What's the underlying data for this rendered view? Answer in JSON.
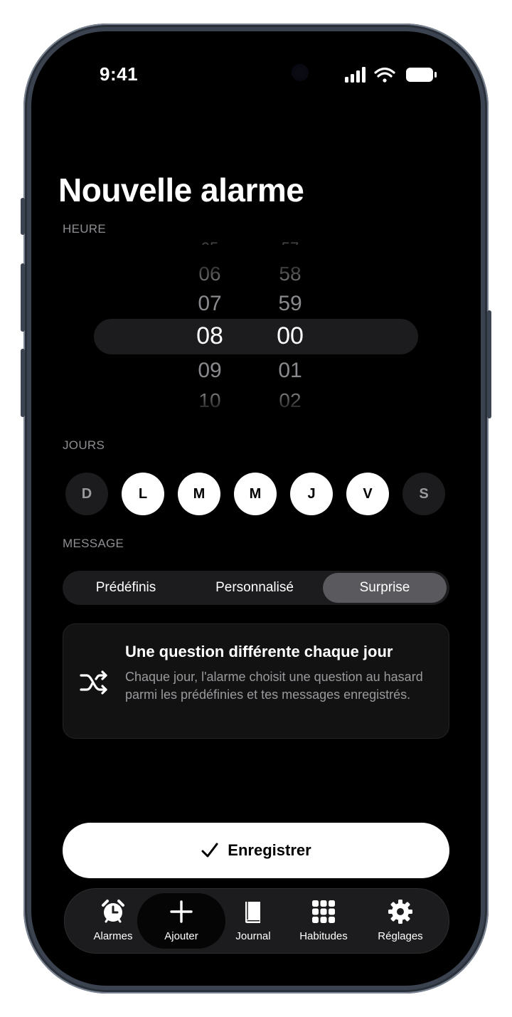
{
  "status": {
    "time": "9:41"
  },
  "page": {
    "title": "Nouvelle alarme"
  },
  "heure": {
    "label": "HEURE",
    "hours": [
      "06",
      "07",
      "08",
      "09",
      "10"
    ],
    "minutes": [
      "58",
      "59",
      "00",
      "01",
      "02"
    ],
    "selected_hour": "08",
    "selected_minute": "00"
  },
  "jours": {
    "label": "JOURS",
    "days": [
      {
        "letter": "D",
        "active": false
      },
      {
        "letter": "L",
        "active": true
      },
      {
        "letter": "M",
        "active": true
      },
      {
        "letter": "M",
        "active": true
      },
      {
        "letter": "J",
        "active": true
      },
      {
        "letter": "V",
        "active": true
      },
      {
        "letter": "S",
        "active": false
      }
    ]
  },
  "message": {
    "label": "MESSAGE",
    "options": [
      "Prédéfinis",
      "Personnalisé",
      "Surprise"
    ],
    "selected": "Surprise"
  },
  "card": {
    "icon": "shuffle-icon",
    "title": "Une question différente chaque jour",
    "body": "Chaque jour, l'alarme choisit une question au hasard parmi les prédéfinies et tes messages enregistrés."
  },
  "save": {
    "icon": "check-icon",
    "label": "Enregistrer"
  },
  "tabbar": {
    "items": [
      {
        "label": "Alarmes",
        "icon": "alarm-clock-icon"
      },
      {
        "label": "Ajouter",
        "icon": "plus-icon"
      },
      {
        "label": "Journal",
        "icon": "book-icon"
      },
      {
        "label": "Habitudes",
        "icon": "grid-icon"
      },
      {
        "label": "Réglages",
        "icon": "gear-icon"
      }
    ],
    "active": "Ajouter"
  },
  "colors": {
    "background": "#000000",
    "surface": "#1c1c1e",
    "accent": "#ffffff",
    "muted": "#8e8e93"
  }
}
